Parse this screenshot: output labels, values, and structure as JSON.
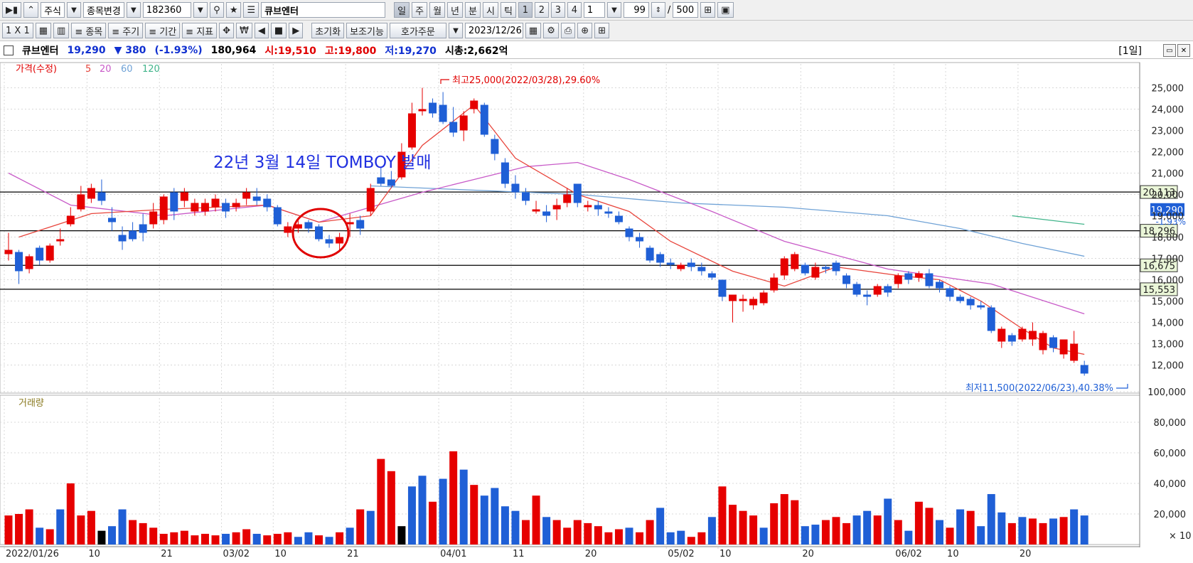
{
  "toolbar1": {
    "market": "주식",
    "change_item": "종목변경",
    "code": "182360",
    "stock_name": "큐브엔터",
    "period_tabs": [
      "일",
      "주",
      "월",
      "년",
      "분",
      "시",
      "틱"
    ],
    "num_tabs": [
      "1",
      "2",
      "3",
      "4"
    ],
    "interval": "1",
    "count": "99",
    "slash": "/",
    "total": "500"
  },
  "toolbar2": {
    "layout": "1 X 1",
    "items": "≡ 종목",
    "periods": "≡ 주기",
    "range": "≡ 기간",
    "indicators": "≡ 지표",
    "reset": "초기화",
    "aux": "보조기능",
    "order": "호가주문",
    "date": "2023/12/26"
  },
  "info": {
    "name": "큐브엔터",
    "price": "19,290",
    "change": "▼ 380",
    "pct": "(-1.93%)",
    "volume": "180,964",
    "open": "시:19,510",
    "high": "고:19,800",
    "low": "저:19,270",
    "mcap": "시총:2,662억",
    "timeframe": "[1일]"
  },
  "legend": {
    "price": "가격(수정)",
    "ma5": "5",
    "ma20": "20",
    "ma60": "60",
    "ma120": "120",
    "volume": "거래량"
  },
  "annotations": {
    "high": "최고25,000(2022/03/28),29.60%",
    "low": "최저11,500(2022/06/23),40.38%",
    "text": "22년 3월 14일 TOMBOY 발매"
  },
  "colors": {
    "up": "#e60000",
    "down": "#1f5fd6",
    "ma5": "#e8453c",
    "ma20": "#c85ac8",
    "ma60": "#6fa2d6",
    "ma120": "#40b48a",
    "annot_blue": "#1f2fe0"
  },
  "chart_data": {
    "type": "candlestick",
    "price_axis": {
      "ticks": [
        "12,000",
        "13,000",
        "14,000",
        "15,000",
        "16,000",
        "17,000",
        "18,000",
        "19,000",
        "20,000",
        "21,000",
        "22,000",
        "23,000",
        "24,000",
        "25,000"
      ]
    },
    "hlines": [
      {
        "value": 20113,
        "label": "20,113"
      },
      {
        "value": 18296,
        "label": "18,296"
      },
      {
        "value": 16675,
        "label": "16,675"
      },
      {
        "value": 15553,
        "label": "15,553"
      }
    ],
    "current": {
      "value": 19290,
      "label": "19,290",
      "pct": "-1.93%"
    },
    "x_labels": [
      {
        "i": 0,
        "label": "2022/01/26"
      },
      {
        "i": 8,
        "label": "10"
      },
      {
        "i": 15,
        "label": "21"
      },
      {
        "i": 21,
        "label": "03/02"
      },
      {
        "i": 26,
        "label": "10"
      },
      {
        "i": 33,
        "label": "21"
      },
      {
        "i": 42,
        "label": "04/01"
      },
      {
        "i": 49,
        "label": "11"
      },
      {
        "i": 56,
        "label": "20"
      },
      {
        "i": 64,
        "label": "05/02"
      },
      {
        "i": 69,
        "label": "10"
      },
      {
        "i": 77,
        "label": "20"
      },
      {
        "i": 86,
        "label": "06/02"
      },
      {
        "i": 91,
        "label": "10"
      },
      {
        "i": 98,
        "label": "20"
      }
    ],
    "candles": [
      [
        17200,
        17400,
        18200,
        16900
      ],
      [
        17300,
        16400,
        17400,
        15800
      ],
      [
        16500,
        17100,
        17200,
        16300
      ],
      [
        17500,
        16900,
        17600,
        16700
      ],
      [
        16900,
        17600,
        17700,
        16800
      ],
      [
        17800,
        17900,
        18400,
        17600
      ],
      [
        18600,
        19000,
        19400,
        18500
      ],
      [
        19300,
        20000,
        20400,
        19200
      ],
      [
        19800,
        20300,
        20500,
        19600
      ],
      [
        20100,
        19700,
        20700,
        19500
      ],
      [
        18900,
        18700,
        19400,
        18300
      ],
      [
        18100,
        17800,
        18500,
        17400
      ],
      [
        18300,
        17900,
        18700,
        17800
      ],
      [
        18600,
        18200,
        19100,
        17800
      ],
      [
        18600,
        19200,
        19600,
        18400
      ],
      [
        18800,
        19900,
        20000,
        18600
      ],
      [
        20100,
        19200,
        20300,
        18800
      ],
      [
        19700,
        20100,
        20300,
        19400
      ],
      [
        19200,
        19600,
        19800,
        19000
      ],
      [
        19200,
        19600,
        19800,
        19000
      ],
      [
        19400,
        19800,
        20000,
        19200
      ],
      [
        19600,
        19200,
        19800,
        18900
      ],
      [
        19400,
        19600,
        19800,
        19200
      ],
      [
        19800,
        20100,
        20300,
        19500
      ],
      [
        19900,
        19700,
        20300,
        19500
      ],
      [
        19800,
        19400,
        20000,
        19200
      ],
      [
        19400,
        18600,
        19500,
        18500
      ],
      [
        18200,
        18500,
        18700,
        18000
      ],
      [
        18400,
        18600,
        18800,
        18200
      ],
      [
        18700,
        18400,
        18800,
        18200
      ],
      [
        18500,
        17900,
        18600,
        17800
      ],
      [
        17900,
        17700,
        18100,
        17500
      ],
      [
        17700,
        18000,
        18200,
        17400
      ],
      [
        18600,
        18700,
        19100,
        18000
      ],
      [
        18800,
        18400,
        19000,
        18100
      ],
      [
        19200,
        20300,
        20500,
        19000
      ],
      [
        20800,
        20500,
        21300,
        20400
      ],
      [
        20700,
        20400,
        21100,
        20300
      ],
      [
        20800,
        22000,
        22400,
        20700
      ],
      [
        22200,
        23800,
        24300,
        22100
      ],
      [
        23900,
        24000,
        25000,
        23700
      ],
      [
        24300,
        23800,
        24500,
        23600
      ],
      [
        24200,
        23400,
        24800,
        23300
      ],
      [
        23400,
        22900,
        24100,
        22700
      ],
      [
        23000,
        23700,
        23900,
        22500
      ],
      [
        24000,
        24400,
        24500,
        23800
      ],
      [
        24200,
        22800,
        24300,
        22700
      ],
      [
        22600,
        21900,
        22800,
        21600
      ],
      [
        21500,
        20500,
        21700,
        20300
      ],
      [
        20500,
        20100,
        20900,
        19800
      ],
      [
        20100,
        19700,
        20300,
        19500
      ],
      [
        19200,
        19300,
        19700,
        19100
      ],
      [
        19200,
        19000,
        19500,
        18700
      ],
      [
        19300,
        19500,
        19800,
        18800
      ],
      [
        19600,
        20000,
        20300,
        19400
      ],
      [
        20500,
        19600,
        20500,
        19400
      ],
      [
        19400,
        19500,
        19700,
        19200
      ],
      [
        19500,
        19300,
        19700,
        19000
      ],
      [
        19200,
        19100,
        19400,
        18900
      ],
      [
        19000,
        18700,
        19200,
        18600
      ],
      [
        18400,
        18000,
        18500,
        17800
      ],
      [
        18000,
        17800,
        18200,
        17500
      ],
      [
        17500,
        16900,
        17600,
        16800
      ],
      [
        17200,
        16800,
        17300,
        16600
      ],
      [
        16800,
        16700,
        17000,
        16500
      ],
      [
        16500,
        16700,
        16800,
        16400
      ],
      [
        16800,
        16600,
        17000,
        16400
      ],
      [
        16600,
        16400,
        16800,
        16200
      ],
      [
        16300,
        16100,
        16400,
        16000
      ],
      [
        16000,
        15200,
        16000,
        15000
      ],
      [
        15000,
        15300,
        15300,
        14000
      ],
      [
        15000,
        15100,
        15300,
        14500
      ],
      [
        14800,
        15100,
        15200,
        14600
      ],
      [
        14900,
        15400,
        15500,
        14800
      ],
      [
        15500,
        16100,
        16300,
        15400
      ],
      [
        16200,
        17000,
        17100,
        16000
      ],
      [
        16500,
        17200,
        17300,
        16400
      ],
      [
        16700,
        16300,
        16800,
        16200
      ],
      [
        16100,
        16600,
        16800,
        16000
      ],
      [
        16600,
        16500,
        16700,
        16300
      ],
      [
        16800,
        16400,
        16900,
        16200
      ],
      [
        16200,
        15800,
        16300,
        15600
      ],
      [
        15800,
        15300,
        15900,
        15200
      ],
      [
        15300,
        15200,
        15500,
        14800
      ],
      [
        15300,
        15700,
        15800,
        15200
      ],
      [
        15700,
        15400,
        15800,
        15200
      ],
      [
        15800,
        16200,
        16300,
        15600
      ],
      [
        16300,
        16000,
        16400,
        15800
      ],
      [
        16100,
        16300,
        16400,
        15900
      ],
      [
        16300,
        15700,
        16500,
        15600
      ],
      [
        15900,
        15600,
        16000,
        15400
      ],
      [
        15600,
        15200,
        15700,
        15000
      ],
      [
        15200,
        15000,
        15300,
        14900
      ],
      [
        15100,
        14800,
        15200,
        14600
      ],
      [
        14800,
        14700,
        15000,
        14600
      ],
      [
        14700,
        13600,
        14800,
        13500
      ],
      [
        13100,
        13700,
        13800,
        12800
      ],
      [
        13400,
        13100,
        13500,
        12900
      ],
      [
        13200,
        13700,
        13800,
        13100
      ],
      [
        13200,
        13600,
        14000,
        12900
      ],
      [
        12700,
        13500,
        13600,
        12500
      ],
      [
        13300,
        12800,
        13400,
        12600
      ],
      [
        12500,
        13200,
        13200,
        12300
      ],
      [
        12200,
        13000,
        13600,
        12100
      ],
      [
        12000,
        11600,
        12200,
        11500
      ]
    ],
    "ma5": [
      [
        1,
        18000
      ],
      [
        8,
        19100
      ],
      [
        15,
        19300
      ],
      [
        25,
        19500
      ],
      [
        30,
        18700
      ],
      [
        35,
        19000
      ],
      [
        40,
        22300
      ],
      [
        45,
        24200
      ],
      [
        49,
        21700
      ],
      [
        55,
        20000
      ],
      [
        60,
        19200
      ],
      [
        64,
        17800
      ],
      [
        70,
        16400
      ],
      [
        75,
        15700
      ],
      [
        80,
        16600
      ],
      [
        86,
        16200
      ],
      [
        90,
        16000
      ],
      [
        94,
        15000
      ],
      [
        98,
        13700
      ],
      [
        101,
        12800
      ],
      [
        104,
        12500
      ]
    ],
    "ma20": [
      [
        0,
        21000
      ],
      [
        6,
        19500
      ],
      [
        15,
        19000
      ],
      [
        25,
        19500
      ],
      [
        30,
        18700
      ],
      [
        40,
        20100
      ],
      [
        50,
        21300
      ],
      [
        55,
        21500
      ],
      [
        60,
        20700
      ],
      [
        68,
        19200
      ],
      [
        75,
        17800
      ],
      [
        85,
        16500
      ],
      [
        95,
        15800
      ],
      [
        104,
        14400
      ]
    ],
    "ma60": [
      [
        35,
        20400
      ],
      [
        45,
        20200
      ],
      [
        55,
        20000
      ],
      [
        65,
        19600
      ],
      [
        75,
        19400
      ],
      [
        85,
        19000
      ],
      [
        92,
        18400
      ],
      [
        98,
        17700
      ],
      [
        104,
        17100
      ]
    ],
    "ma120": [
      [
        97,
        19000
      ],
      [
        104,
        18600
      ]
    ],
    "volume": {
      "axis_ticks": [
        "20,000",
        "40,000",
        "60,000",
        "80,000",
        "100,000"
      ],
      "unit": "× 10",
      "values": [
        190,
        200,
        230,
        110,
        100,
        230,
        400,
        190,
        220,
        90,
        120,
        230,
        160,
        140,
        110,
        70,
        80,
        90,
        60,
        70,
        60,
        70,
        80,
        100,
        70,
        60,
        70,
        80,
        50,
        80,
        60,
        50,
        80,
        110,
        230,
        220,
        560,
        480,
        120,
        380,
        450,
        280,
        430,
        610,
        490,
        390,
        320,
        370,
        250,
        220,
        160,
        320,
        180,
        160,
        110,
        160,
        140,
        120,
        80,
        100,
        110,
        80,
        160,
        240,
        80,
        90,
        50,
        80,
        180,
        380,
        260,
        220,
        190,
        110,
        270,
        330,
        290,
        120,
        130,
        160,
        180,
        140,
        190,
        220,
        190,
        300,
        160,
        90,
        280,
        240,
        160,
        110,
        230,
        220,
        120,
        330,
        210,
        140,
        180,
        170,
        140,
        170,
        180,
        230,
        190
      ],
      "ups": [
        1,
        1,
        1,
        0,
        1,
        0,
        1,
        1,
        1,
        2,
        0,
        0,
        1,
        1,
        1,
        1,
        1,
        1,
        1,
        1,
        1,
        0,
        1,
        1,
        0,
        1,
        1,
        1,
        0,
        0,
        1,
        0,
        1,
        0,
        1,
        0,
        1,
        1,
        2,
        0,
        0,
        1,
        0,
        1,
        0,
        1,
        0,
        0,
        0,
        0,
        1,
        1,
        0,
        1,
        1,
        1,
        1,
        1,
        1,
        1,
        0,
        1,
        1,
        0,
        0,
        0,
        1,
        1,
        0,
        1,
        1,
        1,
        1,
        0,
        1,
        1,
        1,
        0,
        0,
        1,
        1,
        1,
        0,
        0,
        1,
        0,
        1,
        0,
        1,
        1,
        0,
        1,
        0,
        1,
        0,
        0,
        0,
        1,
        0,
        1,
        1,
        0,
        1,
        0,
        0
      ]
    }
  }
}
